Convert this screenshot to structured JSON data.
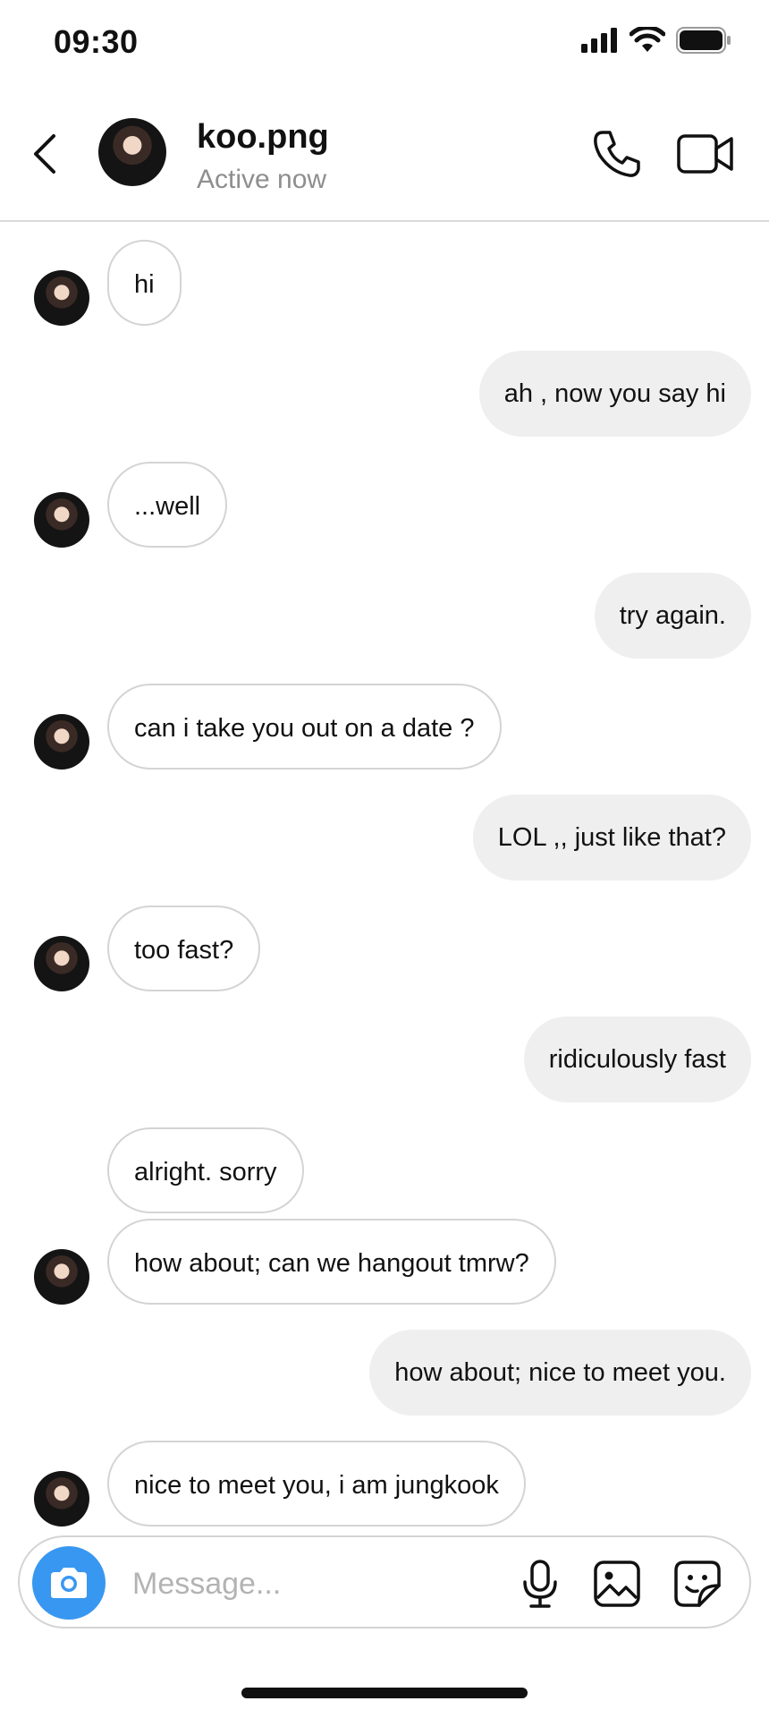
{
  "status_bar": {
    "time": "09:30"
  },
  "header": {
    "name": "koo.png",
    "status": "Active now",
    "icons": {
      "back": "chevron-left-icon",
      "call": "phone-icon",
      "video": "video-camera-icon"
    }
  },
  "messages": [
    {
      "from": "them",
      "text": "hi"
    },
    {
      "from": "me",
      "text": "ah , now you say hi"
    },
    {
      "from": "them",
      "text": "...well"
    },
    {
      "from": "me",
      "text": "try again."
    },
    {
      "from": "them",
      "text": "can i take you out on a date ?"
    },
    {
      "from": "me",
      "text": "LOL ,, just like that?"
    },
    {
      "from": "them",
      "text": "too fast?"
    },
    {
      "from": "me",
      "text": "ridiculously fast"
    },
    {
      "from": "them",
      "text": "alright. sorry"
    },
    {
      "from": "them",
      "text": "how about; can we hangout tmrw?"
    },
    {
      "from": "me",
      "text": "how about; nice to meet you."
    },
    {
      "from": "them",
      "text": "nice to meet you, i am jungkook"
    }
  ],
  "composer": {
    "placeholder": "Message...",
    "value": "",
    "icons": {
      "camera": "camera-icon",
      "mic": "microphone-icon",
      "gallery": "image-icon",
      "sticker": "sticker-icon"
    }
  },
  "colors": {
    "camera_button": "#3897f0",
    "outgoing_bubble": "#efefef",
    "incoming_border": "#d4d4d4"
  }
}
